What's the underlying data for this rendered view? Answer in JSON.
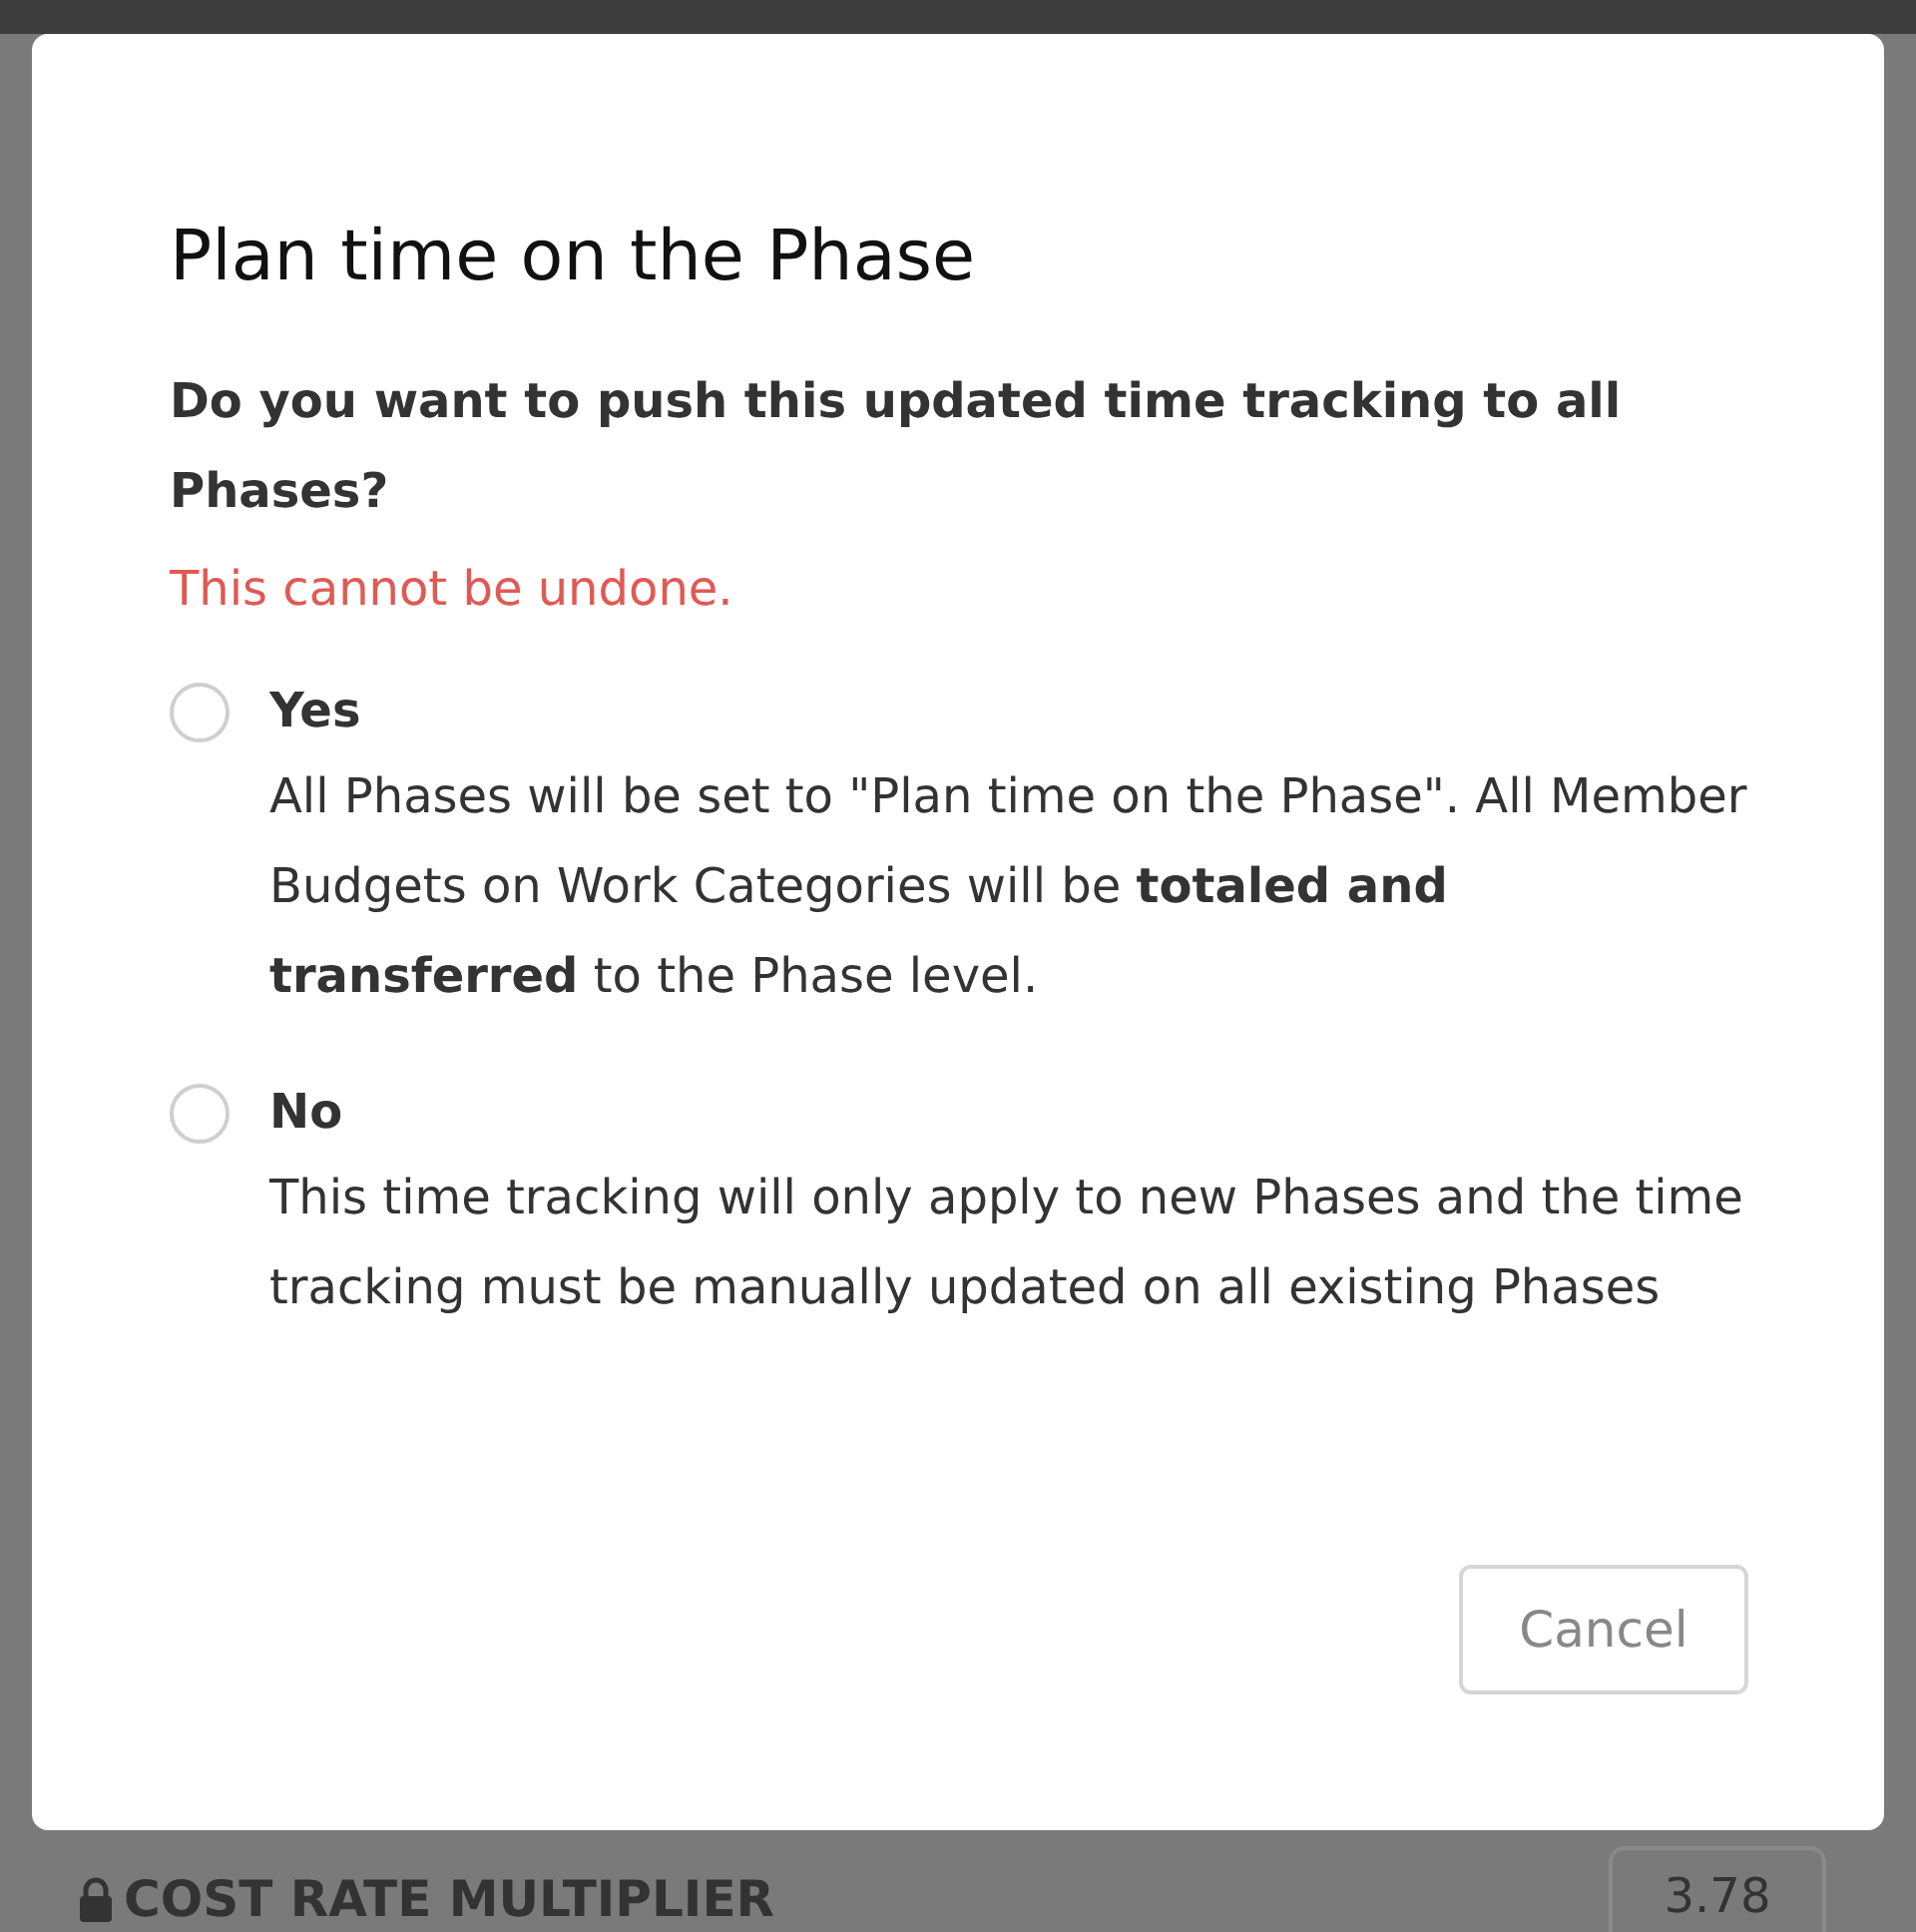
{
  "dialog": {
    "title": "Plan time on the Phase",
    "question": "Do you want to push this updated time tracking to all Phases?",
    "warning": "This cannot be undone.",
    "options": [
      {
        "label": "Yes",
        "description": "All Phases will be set to \"Plan time on the Phase\". All Member Budgets on Work Categories will be **totaled and transferred** to the Phase level.",
        "selected": false
      },
      {
        "label": "No",
        "description": "This time tracking will only apply to new Phases and the time tracking must be manually updated on all existing Phases",
        "selected": false
      }
    ],
    "buttons": [
      "Cancel"
    ]
  },
  "background": {
    "field_label": "COST RATE MULTIPLIER",
    "field_value": "3.78"
  }
}
